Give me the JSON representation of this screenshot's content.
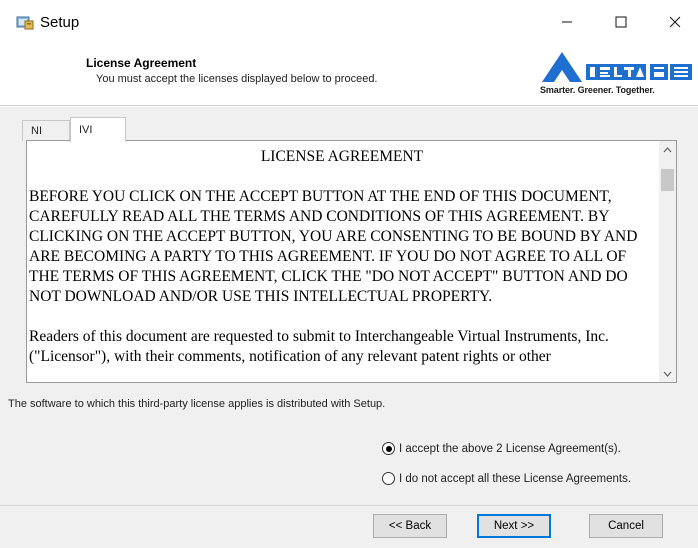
{
  "window": {
    "title": "Setup",
    "icon": "setup-installer-icon",
    "controls": {
      "minimize": "–",
      "maximize": "☐",
      "close": "✕"
    }
  },
  "header": {
    "title": "License Agreement",
    "subtitle": "You must accept the licenses displayed below to proceed.",
    "logo": {
      "brand": "DELTA",
      "brand_cjk": "台達",
      "tagline": "Smarter. Greener. Together.",
      "color": "#1f6fd1"
    }
  },
  "tabs": [
    {
      "label": "NI",
      "active": false
    },
    {
      "label": "IVI",
      "active": true
    }
  ],
  "license": {
    "title": "LICENSE AGREEMENT",
    "paragraph1": "BEFORE YOU CLICK ON THE ACCEPT BUTTON AT THE END OF THIS DOCUMENT, CAREFULLY READ ALL THE TERMS AND CONDITIONS OF THIS AGREEMENT.  BY CLICKING ON THE ACCEPT BUTTON, YOU ARE CONSENTING TO BE BOUND BY AND ARE BECOMING A PARTY TO THIS AGREEMENT.  IF YOU DO NOT AGREE TO ALL OF THE TERMS OF THIS AGREEMENT, CLICK THE \"DO NOT ACCEPT\" BUTTON AND DO NOT DOWNLOAD AND/OR USE THIS INTELLECTUAL PROPERTY.",
    "paragraph2": "Readers of this document are requested to submit to Interchangeable Virtual Instruments, Inc. (\"Licensor\"), with their comments, notification of any relevant patent rights or other"
  },
  "note": "The software to which this third-party license applies is distributed with Setup.",
  "options": {
    "accept": {
      "label": "I accept the above 2 License Agreement(s).",
      "selected": true
    },
    "decline": {
      "label": "I do not accept all these License Agreements.",
      "selected": false
    }
  },
  "buttons": {
    "back": "<< Back",
    "next": "Next >>",
    "cancel": "Cancel"
  }
}
